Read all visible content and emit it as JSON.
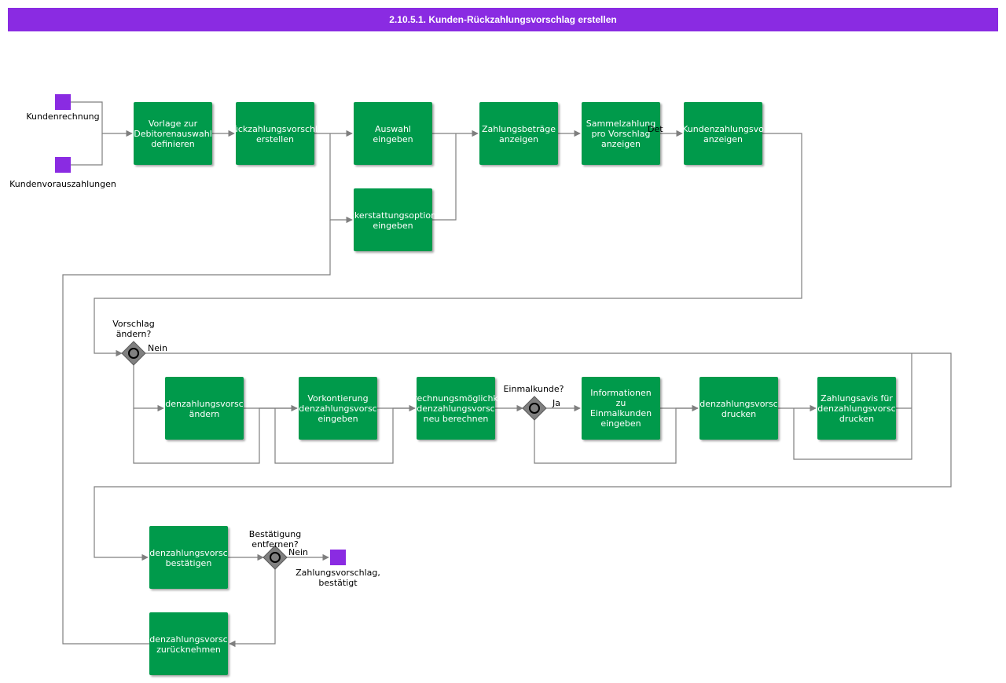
{
  "title": "2.10.5.1. Kunden-Rückzahlungsvorschlag erstellen",
  "colors": {
    "title_bg": "#8a2be2",
    "task": "#009a4b",
    "event": "#8a2be2",
    "gateway": "#808080",
    "edge": "#7f7f7f"
  },
  "events": {
    "kundenrechnung": "Kundenrechnung",
    "kundenvorauszahlungen": "Kundenvorauszahlungen",
    "end_line1": "Zahlungsvorschlag,",
    "end_line2": "bestätigt"
  },
  "tasks": {
    "t1": [
      "Vorlage zur",
      "Debitorenauswahl",
      "definieren"
    ],
    "t2": [
      "ückzahlungsvorschl",
      "erstellen"
    ],
    "t3": [
      "Auswahl",
      "eingeben"
    ],
    "t4": [
      "ckerstattungsoption",
      "eingeben"
    ],
    "t5": [
      "Zahlungsbeträge",
      "anzeigen"
    ],
    "t6": [
      "Sammelzahlung",
      "pro Vorschlag",
      "anzeigen"
    ],
    "t7": [
      "Kundenzahlungsvo",
      "anzeigen"
    ],
    "t8": [
      "denzahlungsvorsc",
      "ändern"
    ],
    "t9": [
      "Vorkontierung",
      "denzahlungsvorsc",
      "eingeben"
    ],
    "t10": [
      "rechnungsmöglichk",
      "denzahlungsvorsc",
      "neu berechnen"
    ],
    "t11": [
      "Informationen",
      "zu",
      "Einmalkunden",
      "eingeben"
    ],
    "t12": [
      "denzahlungsvorsc",
      "drucken"
    ],
    "t13": [
      "Zahlungsavis für",
      "denzahlungsvorsc",
      "drucken"
    ],
    "t14": [
      "denzahlungsvorsc",
      "bestätigen"
    ],
    "t15": [
      "denzahlungsvorsc",
      "zurücknehmen"
    ]
  },
  "gateways": {
    "g1_question": [
      "Vorschlag",
      "ändern?"
    ],
    "g1_branch": "Nein",
    "g2_question": "Einmalkunde?",
    "g2_branch": "Ja",
    "g3_question": [
      "Bestätigung",
      "entfernen?"
    ],
    "g3_branch": "Nein"
  },
  "edge_labels": {
    "detail": "Det"
  }
}
